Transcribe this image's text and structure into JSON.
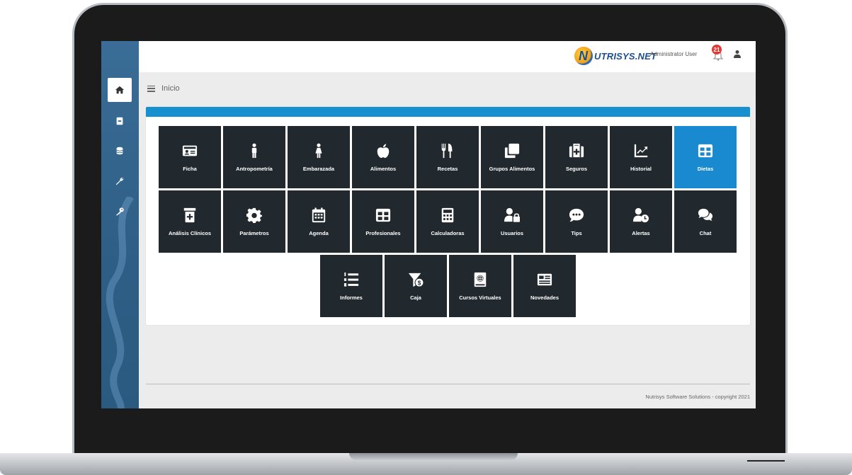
{
  "header": {
    "logo_text": "UTRISYS.NET",
    "logo_letter": "N",
    "user_name": "Administrator User",
    "notification_count": "21"
  },
  "breadcrumb": {
    "title": "Inicio"
  },
  "sidebar": {
    "items": [
      {
        "icon": "home-icon"
      },
      {
        "icon": "address-card-icon"
      },
      {
        "icon": "database-icon"
      },
      {
        "icon": "wrench-icon"
      },
      {
        "icon": "key-icon"
      }
    ]
  },
  "tiles": [
    {
      "label": "Ficha",
      "icon": "id-card-icon"
    },
    {
      "label": "Antropometría",
      "icon": "male-icon"
    },
    {
      "label": "Embarazada",
      "icon": "female-icon"
    },
    {
      "label": "Alimentos",
      "icon": "apple-icon"
    },
    {
      "label": "Recetas",
      "icon": "utensils-icon"
    },
    {
      "label": "Grupos Alimentos",
      "icon": "clone-icon"
    },
    {
      "label": "Seguros",
      "icon": "medkit-icon"
    },
    {
      "label": "Historial",
      "icon": "chart-line-icon"
    },
    {
      "label": "Dietas",
      "icon": "table-icon",
      "active": true
    },
    {
      "label": "Análisis Clínicos",
      "icon": "prescription-bottle-icon"
    },
    {
      "label": "Parámetros",
      "icon": "cog-icon"
    },
    {
      "label": "Agenda",
      "icon": "calendar-icon"
    },
    {
      "label": "Profesionales",
      "icon": "table-icon"
    },
    {
      "label": "Calculadoras",
      "icon": "calculator-icon"
    },
    {
      "label": "Usuarios",
      "icon": "user-lock-icon"
    },
    {
      "label": "Tips",
      "icon": "comment-dots-icon"
    },
    {
      "label": "Alertas",
      "icon": "user-clock-icon"
    },
    {
      "label": "Chat",
      "icon": "comments-icon"
    },
    {
      "label": "Informes",
      "icon": "list-ol-icon"
    },
    {
      "label": "Caja",
      "icon": "funnel-dollar-icon"
    },
    {
      "label": "Cursos Virtuales",
      "icon": "book-atlas-icon"
    },
    {
      "label": "Novedades",
      "icon": "newspaper-icon"
    }
  ],
  "footer": {
    "text": "Nutrisys Software Solutions - copyright 2021"
  },
  "colors": {
    "sidebar": "#2f5f86",
    "tile": "#22292e",
    "active_tile": "#1a8ad0",
    "panel_header": "#1890d0"
  }
}
